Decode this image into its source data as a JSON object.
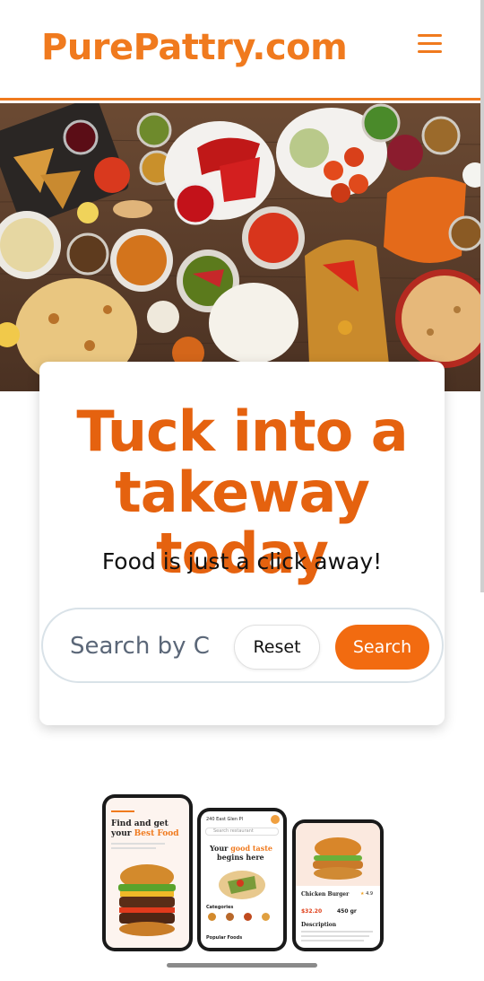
{
  "header": {
    "brand": "PurePattry.com",
    "menu_icon": "hamburger-menu-icon"
  },
  "hero": {
    "image": "indian-food-spread"
  },
  "card": {
    "headline": "Tuck into a takeway today",
    "subline": "Food is just a click away!",
    "search": {
      "placeholder": "Search by C",
      "reset_label": "Reset",
      "search_label": "Search"
    }
  },
  "phones": {
    "phone1": {
      "title_a": "Find and get",
      "title_b": "your",
      "title_accent": "Best Food"
    },
    "phone2": {
      "location": "240 East Glen Pl",
      "search_placeholder": "Search restaurant",
      "title_a": "Your",
      "title_accent": "good taste",
      "title_b": "begins here",
      "categories_label": "Categories",
      "popular_label": "Popular Foods"
    },
    "phone3": {
      "item_name": "Chicken Burger",
      "price": "$32.20",
      "weight": "450 gr",
      "rating": "4.9",
      "description_label": "Description"
    }
  },
  "colors": {
    "accent": "#f07a1e",
    "headline": "#e5620f",
    "button": "#f26b10"
  }
}
